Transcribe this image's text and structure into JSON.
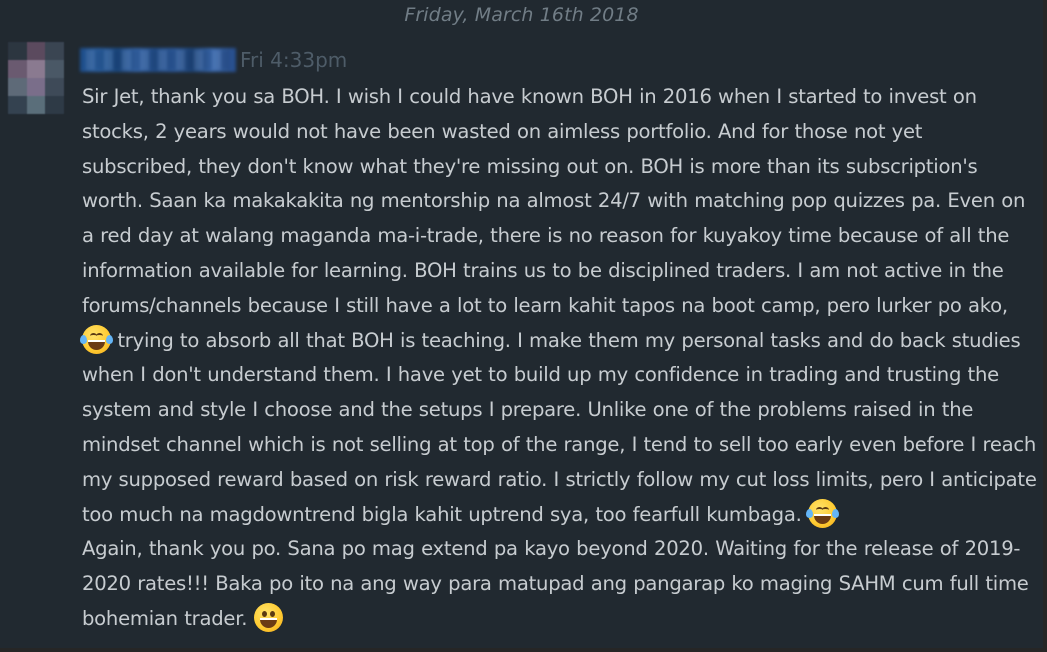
{
  "date_divider": "Friday, March 16th 2018",
  "message": {
    "timestamp": "Fri 4:33pm",
    "text": {
      "part1": "Sir Jet, thank you sa BOH. I wish I could have known BOH in 2016 when I started to invest on stocks, 2 years would not have been wasted on aimless portfolio. And for those not yet subscribed, they don't know what they're missing out on. BOH is more than its subscription's worth. Saan ka makakakita ng mentorship na almost 24/7 with matching pop quizzes pa. Even on a red day at walang maganda ma-i-trade, there is no reason for kuyakoy time because of all the information available for learning. BOH trains us to be disciplined traders. I am not active in the forums/channels because I still have a lot to learn kahit tapos na boot camp, pero lurker po ako,",
      "part2": " trying to absorb all that BOH is teaching. I make them my personal tasks and do back studies when I don't understand them. I have yet to build up my confidence in trading and trusting the system and style I choose and the setups I prepare. Unlike one of the problems raised in the mindset channel which is not selling at top of the range, I tend to sell too early even before I reach my supposed reward based on risk reward ratio. I strictly follow my cut loss limits, pero I anticipate too much na magdowntrend bigla kahit uptrend sya, too fearfull kumbaga.",
      "part3": "Again, thank you po. Sana po mag extend pa kayo beyond 2020. Waiting for the release of 2019-2020 rates!!! Baka po ito na ang way para matupad ang pangarap ko maging SAHM cum full time bohemian trader."
    },
    "emojis": [
      "tears-of-joy-emoji",
      "tears-of-joy-emoji",
      "grinning-face-emoji"
    ]
  },
  "colors": {
    "panel_background": "#212930",
    "message_text": "#c7ccd0",
    "timestamp": "#4e5c68",
    "date_divider": "#717d86",
    "username_redacted": "#2a62a8"
  }
}
